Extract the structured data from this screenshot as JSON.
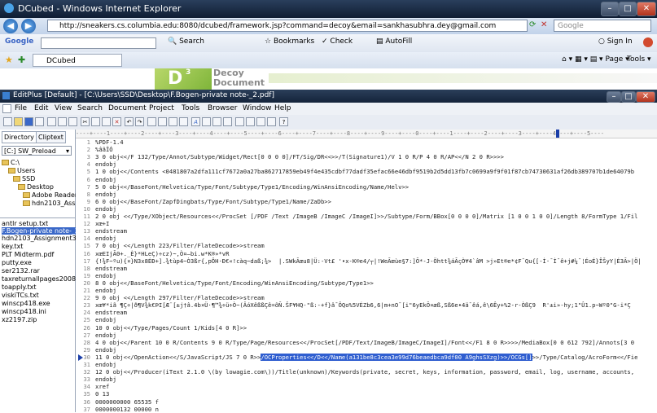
{
  "ie": {
    "title": "DCubed - Windows Internet Explorer",
    "url": "http://sneakers.cs.columbia.edu:8080/dcubed/framework.jsp?command=decoy&email=sankhasubhra.dey@gmail.com",
    "search_placeholder": "Google",
    "tab_label": "DCubed",
    "toolbar": {
      "google_label": "Google",
      "search_label": "Search",
      "bookmarks_label": "Bookmarks",
      "check_label": "Check",
      "autofill_label": "AutoFill",
      "signin_label": "Sign In"
    },
    "command_bar": {
      "page_label": "Page",
      "tools_label": "Tools"
    },
    "banner_letter": "D",
    "banner_superscript": "3",
    "banner_text": "Decoy\nDocument"
  },
  "editplus": {
    "title": "EditPlus [Default] - [C:\\Users\\SSD\\Desktop\\F.Bogen-private note-_2.pdf]",
    "menu": [
      "File",
      "Edit",
      "View",
      "Search",
      "Document",
      "Project",
      "Tools",
      "Browser",
      "Window",
      "Help"
    ],
    "tabs": [
      "Directory",
      "Cliptext"
    ],
    "drive": "[C:] SW_Preload",
    "tree": [
      "C:\\",
      "Users",
      "SSD",
      "Desktop",
      "Adobe Reader 9",
      "hdn2103_Assign"
    ],
    "files": [
      "antlr setup.txt",
      "F.Bogen-private note-_2.p",
      "hdn2103_Assignment3.zip",
      "key.txt",
      "PLT Midterm.pdf",
      "putty.exe",
      "ser2132.rar",
      "taxreturnallpages2008.pdf",
      "toapply.txt",
      "viskiTCs.txt",
      "winscp418.exe",
      "winscp418.ini",
      "xz2197.zip"
    ],
    "ruler": "----+----1----+----2----+----3----+----4----+----5----+----6----+----7----+----8----+----9----+----0----+----1----+----2----+----3----+----4----+----5----",
    "lines": [
      {
        "n": "1",
        "t": "%PDF-1.4"
      },
      {
        "n": "2",
        "t": "%âãÏÓ"
      },
      {
        "n": "3",
        "t": "3 0 obj<</F 132/Type/Annot/Subtype/Widget/Rect[0 0 0 0]/FT/Sig/DR<<>>/T(Signature1)/V 1 0 R/P 4 0 R/AP<</N 2 0 R>>>>"
      },
      {
        "n": "4",
        "t": "endobj"
      },
      {
        "n": "5",
        "t": "1 0 obj<</Contents <0481807a2dfa111cf7672a0a27ba862717859eb49f4e435cdbf77dadf35efac66e46dbf9519b2d5dd13fb7c0699a9f9f01f87cb74730631af26db389707b1de64079b"
      },
      {
        "n": "6",
        "t": "endobj"
      },
      {
        "n": "7",
        "t": "5 0 obj<</BaseFont/Helvetica/Type/Font/Subtype/Type1/Encoding/WinAnsiEncoding/Name/Helv>>"
      },
      {
        "n": "8",
        "t": "endobj"
      },
      {
        "n": "9",
        "t": "6 0 obj<</BaseFont/ZapfDingbats/Type/Font/Subtype/Type1/Name/ZaDb>>"
      },
      {
        "n": "10",
        "t": "endobj"
      },
      {
        "n": "11",
        "t": "2 0 obj <</Type/XObject/Resources<</ProcSet [/PDF /Text /ImageB /ImageC /ImageI]>>/Subtype/Form/BBox[0 0 0 0]/Matrix [1 0 0 1 0 0]/Length 8/FormType 1/Fil"
      },
      {
        "n": "12",
        "t": "xœ+I"
      },
      {
        "n": "13",
        "t": "endstream"
      },
      {
        "n": "14",
        "t": "endobj"
      },
      {
        "n": "15",
        "t": "7 0 obj <</Length 223/Filter/FlateDecode>>stream"
      },
      {
        "n": "16",
        "t": "xœEIjÃ0+._È}*HLeÇ)÷cz)~,Ò¤—bi.w*K®»*vR"
      },
      {
        "n": "17",
        "t": "{!¾F~ºu){¤}N3x8ÉÐ+].¾tùp4~Ò3ßr{,pÔH·Ð€«!càq~daß;¾>  |.SWkÃœu8|Ü:-Vt£ '•x-K®e4/┬|!WeÃœùe§7:]Õ*-J-Öhtt¾áÃçÒ¥4`âM >j»Et®e*¢F¯Qu{[-Ì·¯Ì¯ê+j#¼¯¦ÉoÉ}ÎŠyY|É3Ã>|Ö|"
      },
      {
        "n": "18",
        "t": "endstream"
      },
      {
        "n": "19",
        "t": "endobj"
      },
      {
        "n": "20",
        "t": "8 0 obj<</BaseFont/Helvetica/Type/Font/Encoding/WinAnsiEncoding/Subtype/Type1>>"
      },
      {
        "n": "21",
        "t": "endobj"
      },
      {
        "n": "22",
        "t": "9 0 obj <</Length 297/Filter/FlateDecode>>stream"
      },
      {
        "n": "23",
        "t": "xœ¥*iã ¶Ç÷|ð¶V¾k€ÞI[Æ¨[±j†â.4b¤Ü·¶™¾÷ü÷Ò~(ÂóXêßßÇê=õÑ.ŠF¥HQ-\"ß:-+f}â¯ÔQo%5VÉZb6,6|m+nO¯[i\"6yEkÕ¤æß,Sß6e•4ä¯êá,ê\\6Êy+%2-r-ÒßÇ9  R'±i»-hy;1\"Û1.p~Wº0\"G-i*Ç"
      },
      {
        "n": "24",
        "t": "endstream"
      },
      {
        "n": "25",
        "t": "endobj"
      },
      {
        "n": "26",
        "t": "10 0 obj<</Type/Pages/Count 1/Kids[4 0 R]>>"
      },
      {
        "n": "27",
        "t": "endobj"
      },
      {
        "n": "28",
        "t": "4 0 obj<</Parent 10 0 R/Contents 9 0 R/Type/Page/Resources<</ProcSet[/PDF/Text/ImageB/ImageC/ImageI]/Font<</F1 8 0 R>>>>/MediaBox[0 0 612 792]/Annots[3 0"
      },
      {
        "n": "29",
        "t": "endobj"
      },
      {
        "n": "30",
        "t": "11 0 obj<</OpenAction<</S/JavaScript/JS 7 0 R>>",
        "hl": "/OCProperties<</D<</Name(a131be8c3cea3e99d76beaedbca9df00 A9ghsSXzg)>>/OCGs[]",
        "tail": ">>/Type/Catalog/AcroForm<</Fie"
      },
      {
        "n": "31",
        "t": "endobj"
      },
      {
        "n": "32",
        "t": "12 0 obj<</Producer(iText 2.1.0 \\(by lowagie.com\\))/Title(unknown)/Keywords(private, secret, keys, information, password, email, log, username, accounts,"
      },
      {
        "n": "33",
        "t": "endobj"
      },
      {
        "n": "34",
        "t": "xref"
      },
      {
        "n": "35",
        "t": "0 13"
      },
      {
        "n": "36",
        "t": "0000000000 65535 f"
      },
      {
        "n": "37",
        "t": "0000000132 00000 n"
      }
    ]
  }
}
